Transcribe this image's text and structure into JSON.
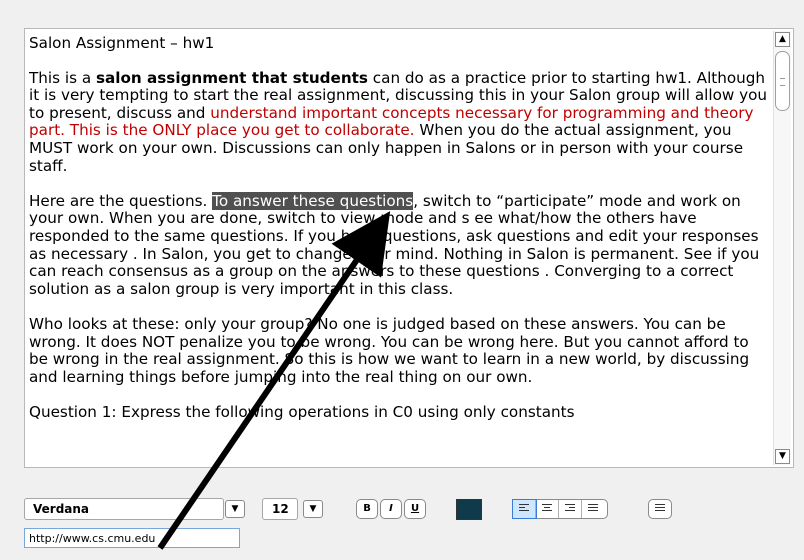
{
  "document": {
    "title_line": "Salon Assignment – hw1",
    "para1": {
      "t1": "This is a ",
      "bold": "salon assignment that students",
      "t2": " can do as a practice prior to starting hw1. Although it is very tempting to start the real assignment, discussing this in your Salon group will allow you to present, discuss and ",
      "red": "understand important concepts necessary for programming and theory part. This is the ONLY place you get to collaborate.",
      "t3": " When you do the actual assignment, you MUST work on your own. Discussions can only happen in Salons or in person with your course staff."
    },
    "para2": {
      "t1": "Here are the questions. ",
      "highlight": "To answer these questions",
      "t2": ", switch to “participate” mode and work on your own. When you are done, switch to view mode and s ee what/how the others have responded to the same questions. If you have questions, ask questions and edit your responses as necessary . In Salon, you get to change your mind. Nothing in Salon is permanent. See if you can reach consensus as a group on the answers to these questions . Converging to a correct solution as a salon group is very important in this class."
    },
    "para3": "Who looks at these: only your group? No one is judged based on these answers. You can be wrong. It does NOT penalize you to be wrong. You can be wrong here. But you cannot afford to be wrong in the real assignment. So this is how we want to learn in a new world, by discussing and learning things before jumping into the real thing on our own.",
    "para4": "Question 1: Express the following operations in C0 using only constants"
  },
  "scrollbar": {
    "up_icon": "▲",
    "down_icon": "▼"
  },
  "toolbar": {
    "font_family": "Verdana",
    "font_size": "12",
    "dropdown_icon": "▼",
    "bold_label": "B",
    "italic_label": "I",
    "underline_label": "U",
    "text_color": "#0f3a4a",
    "alignment_active": "left"
  },
  "url_field": {
    "value": "http://www.cs.cmu.edu"
  },
  "annotation": {
    "arrow_color": "#000000"
  }
}
